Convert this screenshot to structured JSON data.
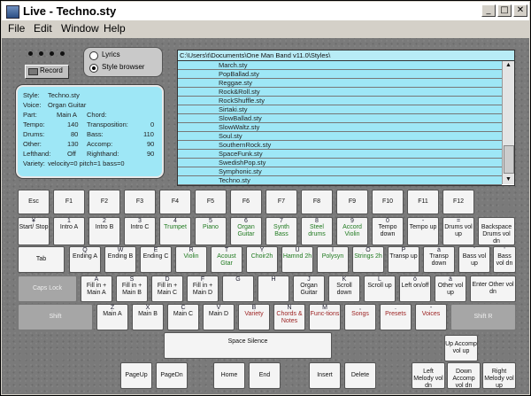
{
  "window": {
    "title": "Live - Techno.sty",
    "minimize": "_",
    "maximize": "□",
    "close": "✕"
  },
  "menu": [
    "File",
    "Edit",
    "Window",
    "Help"
  ],
  "recorder": {
    "label": "Record"
  },
  "mode": {
    "options": [
      "Lyrics",
      "Style browser"
    ],
    "selected": "Style browser"
  },
  "info": {
    "style": {
      "label": "Style:",
      "value": "Techno.sty"
    },
    "voice": {
      "label": "Voice:",
      "value": "Organ Guitar"
    },
    "part": {
      "label": "Part:",
      "value": "Main A"
    },
    "chord": {
      "label": "Chord:",
      "value": ""
    },
    "tempo": {
      "label": "Tempo:",
      "value": "140"
    },
    "transposition": {
      "label": "Transposition:",
      "value": "0"
    },
    "drums": {
      "label": "Drums:",
      "value": "80"
    },
    "bass": {
      "label": "Bass:",
      "value": "110"
    },
    "other": {
      "label": "Other:",
      "value": "130"
    },
    "accomp": {
      "label": "Accomp:",
      "value": "90"
    },
    "lefthand": {
      "label": "Lefthand:",
      "value": "Off"
    },
    "righthand": {
      "label": "Righthand:",
      "value": "90"
    },
    "variety": {
      "label": "Variety:",
      "value": "velocity=0 pitch=1 bass=0"
    }
  },
  "browser": {
    "path": "C:\\Users\\t\\Documents\\One Man Band v11.0\\Styles\\",
    "files": [
      "March.sty",
      "PopBallad.sty",
      "Reggae.sty",
      "Rock&Roll.sty",
      "RockShuffle.sty",
      "Sirtaki.sty",
      "SlowBallad.sty",
      "SlowWaltz.sty",
      "Soul.sty",
      "SouthernRock.sty",
      "SpaceFunk.sty",
      "SwedishPop.sty",
      "Symphonic.sty",
      "Techno.sty"
    ],
    "selected": "Techno.sty",
    "scroll_up": "▲",
    "scroll_down": "▼"
  },
  "keys": {
    "esc": {
      "label": "Esc"
    },
    "f1": {
      "label": "F1"
    },
    "f2": {
      "label": "F2"
    },
    "f3": {
      "label": "F3"
    },
    "f4": {
      "label": "F4"
    },
    "f5": {
      "label": "F5"
    },
    "f6": {
      "label": "F6"
    },
    "f7": {
      "label": "F7"
    },
    "f8": {
      "label": "F8"
    },
    "f9": {
      "label": "F9"
    },
    "f10": {
      "label": "F10"
    },
    "f11": {
      "label": "F11"
    },
    "f12": {
      "label": "F12"
    },
    "k_tilde": {
      "top": "¥",
      "label": "Start/ Stop"
    },
    "k1": {
      "top": "1",
      "label": "Intro A"
    },
    "k2": {
      "top": "2",
      "label": "Intro B"
    },
    "k3": {
      "top": "3",
      "label": "Intro C"
    },
    "k4": {
      "top": "4",
      "label": "Trumpet"
    },
    "k5": {
      "top": "5",
      "label": "Piano"
    },
    "k6": {
      "top": "6",
      "label": "Organ Guitar"
    },
    "k7": {
      "top": "7",
      "label": "Synth Bass"
    },
    "k8": {
      "top": "8",
      "label": "Steel drums"
    },
    "k9": {
      "top": "9",
      "label": "Accord Violin"
    },
    "k0": {
      "top": "0",
      "label": "Tempo down"
    },
    "kminus": {
      "top": "-",
      "label": "Tempo up"
    },
    "kequal": {
      "top": "=",
      "label": "Drums vol up"
    },
    "backspace": {
      "label": "Backspace Drums vol dn"
    },
    "tab": {
      "label": "Tab"
    },
    "kq": {
      "top": "Q",
      "label": "Ending A"
    },
    "kw": {
      "top": "W",
      "label": "Ending B"
    },
    "ke": {
      "top": "E",
      "label": "Ending C"
    },
    "kr": {
      "top": "R",
      "label": "Violin"
    },
    "kt": {
      "top": "T",
      "label": "Acoust Gtar"
    },
    "ky": {
      "top": "Y",
      "label": "Choir2h"
    },
    "ku": {
      "top": "U",
      "label": "Hamnd 2h"
    },
    "ki": {
      "top": "I",
      "label": "Polysyn"
    },
    "ko": {
      "top": "O",
      "label": "Strings 2h"
    },
    "kp": {
      "top": "P",
      "label": "Transp up"
    },
    "klbr": {
      "top": "å",
      "label": "Transp down"
    },
    "krbr": {
      "top": "¨",
      "label": "Bass vol up"
    },
    "kbsl": {
      "top": "'",
      "label": "Bass vol dn"
    },
    "caps": {
      "label": "Caps Lock"
    },
    "ka": {
      "top": "A",
      "label": "Fill in + Main A"
    },
    "ks": {
      "top": "S",
      "label": "Fill in + Main B"
    },
    "kd": {
      "top": "D",
      "label": "Fill in + Main C"
    },
    "kf": {
      "top": "F",
      "label": "Fill in + Main D"
    },
    "kg": {
      "top": "G",
      "label": ""
    },
    "kh": {
      "top": "H",
      "label": ""
    },
    "kj": {
      "top": "J",
      "label": "Organ Guitar"
    },
    "kk": {
      "top": "K",
      "label": "Scroll down"
    },
    "kl": {
      "top": "L",
      "label": "Scroll up"
    },
    "ksemi": {
      "top": "ö",
      "label": "Left on/off"
    },
    "kquote": {
      "top": "ä",
      "label": "Other vol up"
    },
    "enter": {
      "label": "Enter Other vol dn"
    },
    "shift_l": {
      "label": "Shift"
    },
    "kz": {
      "top": "Z",
      "label": "Main A"
    },
    "kx": {
      "top": "X",
      "label": "Main B"
    },
    "kc": {
      "top": "C",
      "label": "Main C"
    },
    "kv": {
      "top": "V",
      "label": "Main D"
    },
    "kb": {
      "top": "B",
      "label": "Variety"
    },
    "kn": {
      "top": "N",
      "label": "Chords & Notes"
    },
    "km": {
      "top": "M",
      "label": "Func-tions"
    },
    "kcomma": {
      "top": ",",
      "label": "Songs"
    },
    "kperiod": {
      "top": ".",
      "label": "Presets"
    },
    "kslash": {
      "top": "-",
      "label": "Voices"
    },
    "shift_r": {
      "label": "Shift R"
    },
    "space": {
      "label": "Space Silence"
    },
    "pgup": {
      "label": "PageUp"
    },
    "pgdn": {
      "label": "PageDn"
    },
    "home": {
      "label": "Home"
    },
    "end": {
      "label": "End"
    },
    "insert": {
      "label": "Insert"
    },
    "delete": {
      "label": "Delete"
    },
    "up": {
      "label": "Up Accomp vol up"
    },
    "left": {
      "label": "Left Melody vol dn"
    },
    "down": {
      "label": "Down Accomp vol dn"
    },
    "right": {
      "label": "Right Melody vol up"
    }
  },
  "colors": {
    "info_bg": "#9ee7f6",
    "list_bg": "#9ee7f6",
    "panel_bg": "#7a7a7a",
    "green_label": "#1f7a1f",
    "red_label": "#9b1f1f"
  }
}
